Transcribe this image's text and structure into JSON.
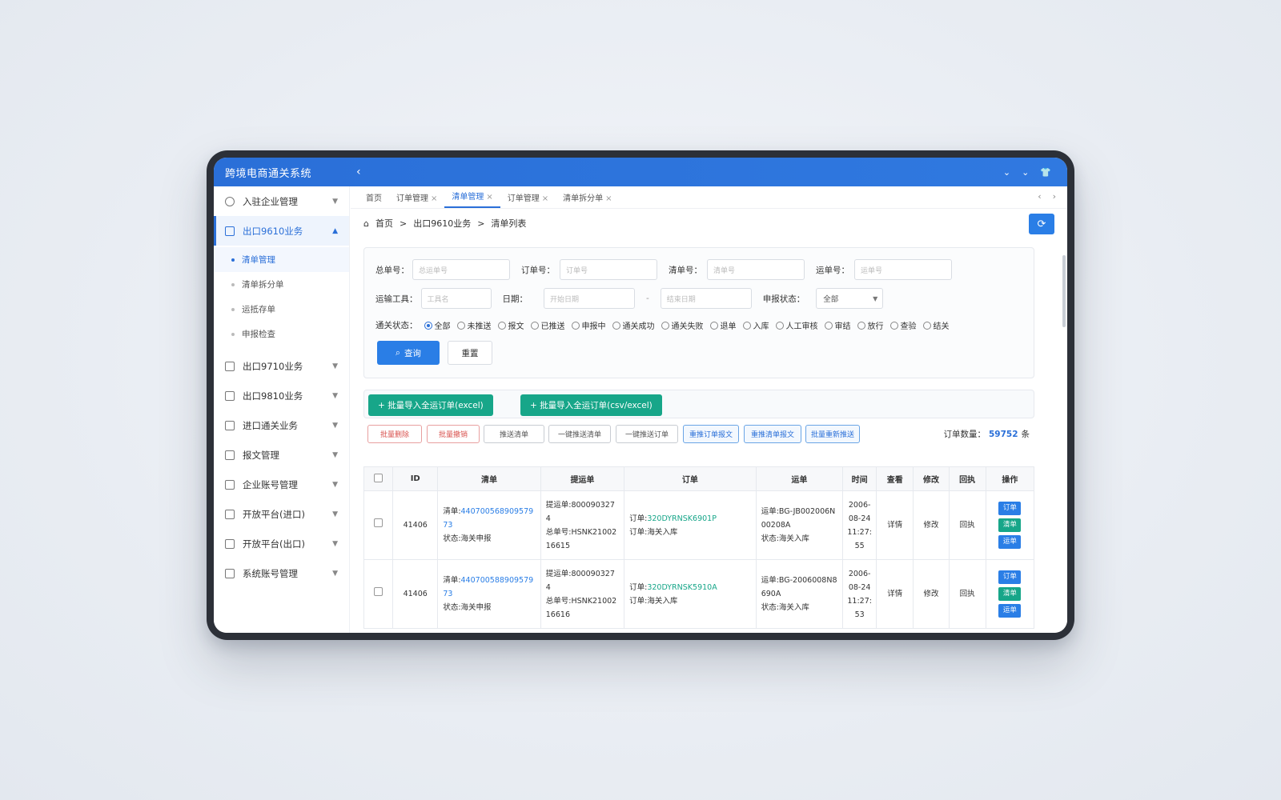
{
  "app": {
    "title": "跨境电商通关系统"
  },
  "sidebar": {
    "items": [
      {
        "label": "入驻企业管理"
      },
      {
        "label": "出口9610业务",
        "sub": [
          "清单管理",
          "清单拆分单",
          "运抵存单",
          "申报检查"
        ]
      },
      {
        "label": "出口9710业务"
      },
      {
        "label": "出口9810业务"
      },
      {
        "label": "进口通关业务"
      },
      {
        "label": "报文管理"
      },
      {
        "label": "企业账号管理"
      },
      {
        "label": "开放平台(进口)"
      },
      {
        "label": "开放平台(出口)"
      },
      {
        "label": "系统账号管理"
      }
    ]
  },
  "tabs": [
    {
      "label": "首页"
    },
    {
      "label": "订单管理"
    },
    {
      "label": "清单管理"
    },
    {
      "label": "订单管理"
    },
    {
      "label": "清单拆分单"
    }
  ],
  "breadcrumb": {
    "home": "首页",
    "section": "出口9610业务",
    "page": "清单列表"
  },
  "filters": {
    "zongdan_label": "总单号：",
    "zongdan_ph": "总运单号",
    "order_label": "订单号：",
    "order_ph": "订单号",
    "list_label": "清单号：",
    "list_ph": "清单号",
    "waybill_label": "运单号：",
    "waybill_ph": "运单号",
    "tool_label": "运输工具：",
    "tool_ph": "工具名",
    "date_label": "日期：",
    "date_start_ph": "开始日期",
    "date_sep": "-",
    "date_end_ph": "结束日期",
    "status_label": "申报状态：",
    "status_value": "全部",
    "clear_label": "通关状态：",
    "radios": [
      "全部",
      "未推送",
      "报文",
      "已推送",
      "申报中",
      "通关成功",
      "通关失败",
      "退单",
      "入库",
      "人工审核",
      "审结",
      "放行",
      "查验",
      "结关"
    ],
    "query_btn": "查询",
    "reset_btn": "重置"
  },
  "import": {
    "btn1": "+ 批量导入全运订单(excel)",
    "btn2": "+ 批量导入全运订单(csv/excel)"
  },
  "actions": [
    {
      "label": "批量删除",
      "style": "red"
    },
    {
      "label": "批量撤销",
      "style": "red"
    },
    {
      "label": "推送清单",
      "style": "gray"
    },
    {
      "label": "一键推送清单",
      "style": "gray"
    },
    {
      "label": "一键推送订单",
      "style": "gray"
    },
    {
      "label": "重推订单报文",
      "style": "blue"
    },
    {
      "label": "重推清单报文",
      "style": "blue"
    },
    {
      "label": "批量重新推送",
      "style": "blue"
    }
  ],
  "order_count": {
    "label": "订单数量：",
    "value": "59752",
    "unit": "条"
  },
  "table": {
    "headers": [
      "",
      "ID",
      "清单",
      "提运单",
      "订单",
      "运单",
      "时间",
      "查看",
      "修改",
      "回执",
      "操作"
    ],
    "rows": [
      {
        "id": "41406",
        "list_label": "清单:",
        "list_no": "44070056890957973",
        "list_status": "状态:海关申报",
        "tiyun_label": "提运单:",
        "tiyun_no": "8000903274",
        "zongdan": "总单号:HSNK2100216615",
        "order_label": "订单:",
        "order_no": "320DYRNSK6901P",
        "order_status": "订单:海关入库",
        "waybill_no": "运单:BG-JB002006N00208A",
        "waybill_status": "状态:海关入库",
        "time": "2006-08-24 11:27:55",
        "view": "详情",
        "edit": "修改",
        "receipt": "回执",
        "ops": [
          "订单",
          "清单",
          "运单"
        ]
      },
      {
        "id": "41406",
        "list_label": "清单:",
        "list_no": "44070058890957973",
        "list_status": "状态:海关申报",
        "tiyun_label": "提运单:",
        "tiyun_no": "8000903274",
        "zongdan": "总单号:HSNK2100216616",
        "order_label": "订单:",
        "order_no": "320DYRNSK5910A",
        "order_status": "订单:海关入库",
        "waybill_no": "运单:BG-2006008N8690A",
        "waybill_status": "状态:海关入库",
        "time": "2006-08-24 11:27:53",
        "view": "详情",
        "edit": "修改",
        "receipt": "回执",
        "ops": [
          "订单",
          "清单",
          "运单"
        ]
      }
    ]
  },
  "colors": {
    "primary": "#2a7ee6",
    "green": "#17a689",
    "red": "#d9534f",
    "topbar": "#2a6fd8"
  }
}
